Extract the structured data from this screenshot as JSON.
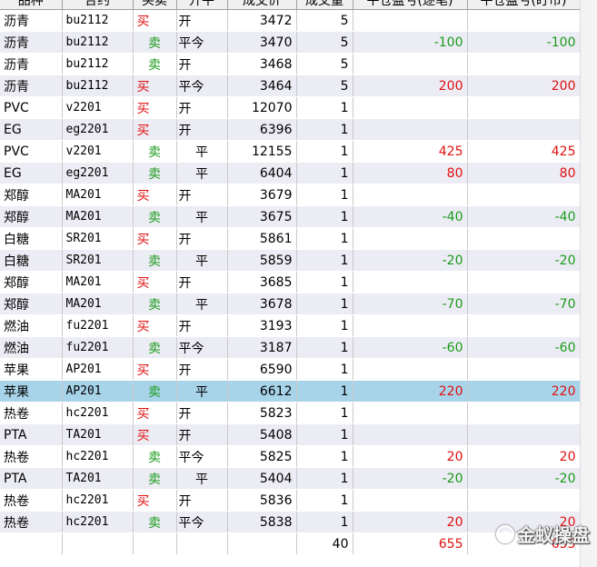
{
  "headers": [
    "品种",
    "合约",
    "买卖",
    "开平",
    "成交价",
    "成交量",
    "平仓盈亏(逐笔)",
    "平仓盈亏(盯市)"
  ],
  "rows": [
    {
      "name": "沥青",
      "contract": "bu2112",
      "dir": "买",
      "oc": "开",
      "price": "3472",
      "qty": "5",
      "pnl1": "",
      "pnl2": ""
    },
    {
      "name": "沥青",
      "contract": "bu2112",
      "dir": "卖",
      "oc": "平今",
      "price": "3470",
      "qty": "5",
      "pnl1": "-100",
      "pnl2": "-100"
    },
    {
      "name": "沥青",
      "contract": "bu2112",
      "dir": "卖",
      "oc": "开",
      "price": "3468",
      "qty": "5",
      "pnl1": "",
      "pnl2": ""
    },
    {
      "name": "沥青",
      "contract": "bu2112",
      "dir": "买",
      "oc": "平今",
      "price": "3464",
      "qty": "5",
      "pnl1": "200",
      "pnl2": "200"
    },
    {
      "name": "PVC",
      "contract": "v2201",
      "dir": "买",
      "oc": "开",
      "price": "12070",
      "qty": "1",
      "pnl1": "",
      "pnl2": ""
    },
    {
      "name": "EG",
      "contract": "eg2201",
      "dir": "买",
      "oc": "开",
      "price": "6396",
      "qty": "1",
      "pnl1": "",
      "pnl2": ""
    },
    {
      "name": "PVC",
      "contract": "v2201",
      "dir": "卖",
      "oc": "平",
      "price": "12155",
      "qty": "1",
      "pnl1": "425",
      "pnl2": "425"
    },
    {
      "name": "EG",
      "contract": "eg2201",
      "dir": "卖",
      "oc": "平",
      "price": "6404",
      "qty": "1",
      "pnl1": "80",
      "pnl2": "80"
    },
    {
      "name": "郑醇",
      "contract": "MA201",
      "dir": "买",
      "oc": "开",
      "price": "3679",
      "qty": "1",
      "pnl1": "",
      "pnl2": ""
    },
    {
      "name": "郑醇",
      "contract": "MA201",
      "dir": "卖",
      "oc": "平",
      "price": "3675",
      "qty": "1",
      "pnl1": "-40",
      "pnl2": "-40"
    },
    {
      "name": "白糖",
      "contract": "SR201",
      "dir": "买",
      "oc": "开",
      "price": "5861",
      "qty": "1",
      "pnl1": "",
      "pnl2": ""
    },
    {
      "name": "白糖",
      "contract": "SR201",
      "dir": "卖",
      "oc": "平",
      "price": "5859",
      "qty": "1",
      "pnl1": "-20",
      "pnl2": "-20"
    },
    {
      "name": "郑醇",
      "contract": "MA201",
      "dir": "买",
      "oc": "开",
      "price": "3685",
      "qty": "1",
      "pnl1": "",
      "pnl2": ""
    },
    {
      "name": "郑醇",
      "contract": "MA201",
      "dir": "卖",
      "oc": "平",
      "price": "3678",
      "qty": "1",
      "pnl1": "-70",
      "pnl2": "-70"
    },
    {
      "name": "燃油",
      "contract": "fu2201",
      "dir": "买",
      "oc": "开",
      "price": "3193",
      "qty": "1",
      "pnl1": "",
      "pnl2": ""
    },
    {
      "name": "燃油",
      "contract": "fu2201",
      "dir": "卖",
      "oc": "平今",
      "price": "3187",
      "qty": "1",
      "pnl1": "-60",
      "pnl2": "-60"
    },
    {
      "name": "苹果",
      "contract": "AP201",
      "dir": "买",
      "oc": "开",
      "price": "6590",
      "qty": "1",
      "pnl1": "",
      "pnl2": ""
    },
    {
      "name": "苹果",
      "contract": "AP201",
      "dir": "卖",
      "oc": "平",
      "price": "6612",
      "qty": "1",
      "pnl1": "220",
      "pnl2": "220",
      "selected": true
    },
    {
      "name": "热卷",
      "contract": "hc2201",
      "dir": "买",
      "oc": "开",
      "price": "5823",
      "qty": "1",
      "pnl1": "",
      "pnl2": ""
    },
    {
      "name": "PTA",
      "contract": "TA201",
      "dir": "买",
      "oc": "开",
      "price": "5408",
      "qty": "1",
      "pnl1": "",
      "pnl2": ""
    },
    {
      "name": "热卷",
      "contract": "hc2201",
      "dir": "卖",
      "oc": "平今",
      "price": "5825",
      "qty": "1",
      "pnl1": "20",
      "pnl2": "20"
    },
    {
      "name": "PTA",
      "contract": "TA201",
      "dir": "卖",
      "oc": "平",
      "price": "5404",
      "qty": "1",
      "pnl1": "-20",
      "pnl2": "-20"
    },
    {
      "name": "热卷",
      "contract": "hc2201",
      "dir": "买",
      "oc": "开",
      "price": "5836",
      "qty": "1",
      "pnl1": "",
      "pnl2": ""
    },
    {
      "name": "热卷",
      "contract": "hc2201",
      "dir": "卖",
      "oc": "平今",
      "price": "5838",
      "qty": "1",
      "pnl1": "20",
      "pnl2": "20"
    }
  ],
  "totals": {
    "qty": "40",
    "pnl1": "655",
    "pnl2": "655"
  },
  "watermark": {
    "text": "金蚁操盘",
    "icon": "brand-logo-icon"
  },
  "colors": {
    "buy": "#e01010",
    "sell": "#1a9b1a",
    "selected_row": "#a8d4ea",
    "alt_row": "#ececf4"
  }
}
